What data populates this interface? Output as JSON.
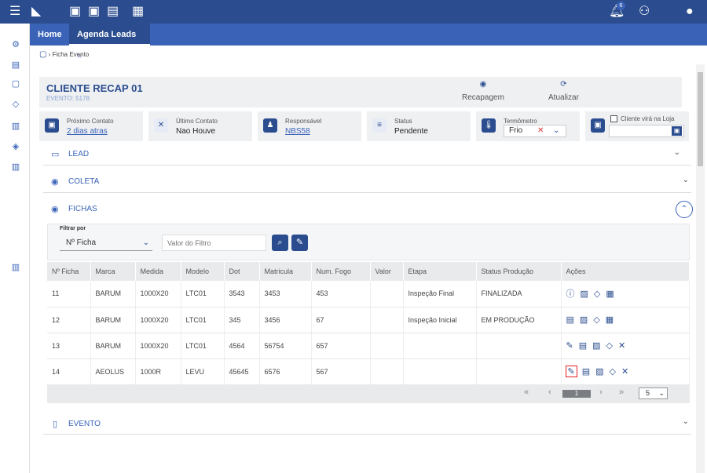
{
  "topbar": {
    "notification_count": "6"
  },
  "tabs": [
    {
      "label": "Home"
    },
    {
      "label": "Agenda Leads"
    }
  ],
  "tab_close": "×",
  "breadcrumb": "Ficha Evento",
  "header": {
    "title": "CLIENTE RECAP 01",
    "subtitle": "EVENTO: 5178",
    "recap_label": "Recapagem",
    "refresh_label": "Atualizar"
  },
  "cards": {
    "proximo": {
      "label": "Próximo Contato",
      "value": "2 dias atras"
    },
    "ultimo": {
      "label": "Último Contato",
      "value": "Nao Houve"
    },
    "responsavel": {
      "label": "Responsável",
      "value": "NBS58"
    },
    "status": {
      "label": "Status",
      "value": "Pendente"
    },
    "termometro": {
      "label": "Termômetro",
      "value": "Frio"
    },
    "cliente": {
      "label": "Cliente virá na Loja"
    }
  },
  "sections": {
    "lead": "LEAD",
    "coleta": "COLETA",
    "fichas": "FICHAS",
    "evento": "EVENTO"
  },
  "filter": {
    "label": "Filtrar por",
    "select": "Nº Ficha",
    "placeholder": "Valor do Filtro"
  },
  "table": {
    "headers": [
      "Nº Ficha",
      "Marca",
      "Medida",
      "Modelo",
      "Dot",
      "Matricula",
      "Num. Fogo",
      "Valor",
      "Etapa",
      "Status Produção",
      "Ações"
    ],
    "rows": [
      [
        "11",
        "BARUM",
        "1000X20",
        "LTC01",
        "3543",
        "3453",
        "453",
        "",
        "Inspeção Final",
        "FINALIZADA"
      ],
      [
        "12",
        "BARUM",
        "1000X20",
        "LTC01",
        "345",
        "3456",
        "67",
        "",
        "Inspeção Inicial",
        "EM PRODUÇÃO"
      ],
      [
        "13",
        "BARUM",
        "1000X20",
        "LTC01",
        "4564",
        "56754",
        "657",
        "",
        "",
        ""
      ],
      [
        "14",
        "AEOLUS",
        "1000R",
        "LEVU",
        "45645",
        "6576",
        "567",
        "",
        "",
        ""
      ]
    ]
  },
  "pagination": {
    "first": "«",
    "prev": "‹",
    "page": "1",
    "next": "›",
    "last": "»",
    "per_page": "5"
  }
}
